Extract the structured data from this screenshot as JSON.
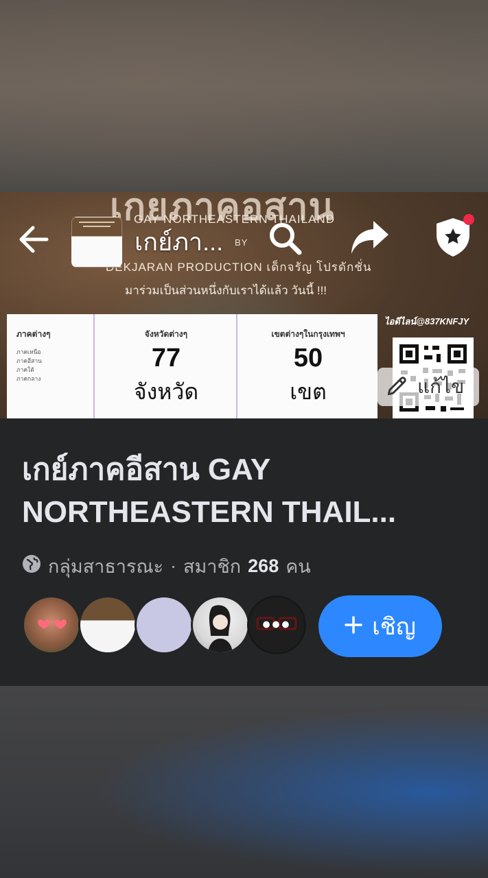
{
  "header": {
    "title": "เกย์ภา...",
    "back_icon": "arrow-left-icon",
    "search_icon": "search-icon",
    "share_icon": "share-icon",
    "admin_icon": "shield-star-icon",
    "notification_dot_color": "#f0284a"
  },
  "cover": {
    "headline": "เกยภาคอสาน",
    "subtitle": "GAY NORTHEASTERN THAILAND",
    "by": "BY",
    "producer": "DEKJARAN PRODUCTION เด็กจรัญ โปรดักชั่น",
    "tagline": "มาร่วมเป็นส่วนหนึ่งกับเราได้แล้ว วันนี้ !!!",
    "columns": {
      "regions": {
        "title": "ภาคต่างๆ",
        "items": [
          "ภาคเหนือ",
          "ภาคอีสาน",
          "ภาคใต้",
          "ภาคกลาง"
        ]
      },
      "provinces": {
        "title": "จังหวัดต่างๆ",
        "number": "77",
        "unit": "จังหวัด"
      },
      "districts": {
        "title": "เขตต่างๆในกรุงเทพฯ",
        "number": "50",
        "unit": "เขต"
      }
    },
    "line_id": "ไอดีไลน์@837KNFJY",
    "edit_label": "แก้ไข",
    "edit_icon": "pencil-icon"
  },
  "group": {
    "name": "เกย์ภาคอีสาน GAY NORTHEASTERN THAIL...",
    "privacy_icon": "globe-icon",
    "privacy": "กลุ่มสาธารณะ",
    "separator": "·",
    "members_label": "สมาชิก",
    "member_count": "268",
    "members_unit": "คน",
    "more_members": "•••",
    "invite_label": "เชิญ",
    "invite_icon": "plus-icon",
    "invite_color": "#2d88ff"
  }
}
